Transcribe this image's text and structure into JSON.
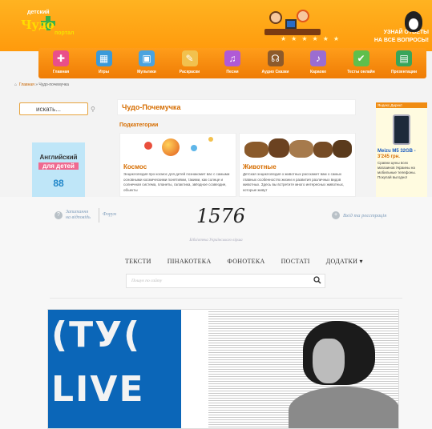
{
  "top_site": {
    "logo": {
      "prefix": "детский",
      "name_a": "Чудо",
      "name_b": "Чудо",
      "suffix": "портал"
    },
    "slogan_line1": "УЗНАЙ ОТВЕТЫ",
    "slogan_line2": "НА ВСЕ ВОПРОСЫ!",
    "nav": [
      {
        "label": "Главная",
        "icon": "puzzle-icon",
        "color": "#e94f8a",
        "glyph": "✚"
      },
      {
        "label": "Игры",
        "icon": "blocks-icon",
        "color": "#3b9ad9",
        "glyph": "▦"
      },
      {
        "label": "Мультики",
        "icon": "tv-icon",
        "color": "#4aa3df",
        "glyph": "▣"
      },
      {
        "label": "Раскраски",
        "icon": "palette-icon",
        "color": "#f2c14e",
        "glyph": "✎"
      },
      {
        "label": "Песни",
        "icon": "music-icon",
        "color": "#b05ad6",
        "glyph": "♫"
      },
      {
        "label": "Аудио Сказки",
        "icon": "audio-tales-icon",
        "color": "#8d5a2b",
        "glyph": "☊"
      },
      {
        "label": "Караоке",
        "icon": "karaoke-icon",
        "color": "#9b6dd1",
        "glyph": "♪"
      },
      {
        "label": "Тесты онлайн",
        "icon": "tests-icon",
        "color": "#5fbf4c",
        "glyph": "✔"
      },
      {
        "label": "Презентации",
        "icon": "presentation-icon",
        "color": "#38a55a",
        "glyph": "▤"
      }
    ],
    "breadcrumb": {
      "home": "Главная",
      "sep": "»",
      "current": "Чудо-почемучка"
    },
    "search_placeholder": "искать...",
    "page_title": "Чудо-Почемучка",
    "subcategories_title": "Подкатегории",
    "cards": [
      {
        "title": "Космос",
        "text": "Энциклопедия про космос для детей познакомит вас с самыми основными космическими понятиями, такими, как солнце и солнечная система, планеты, галактика, звёздное созвездие, объекты"
      },
      {
        "title": "Животные",
        "text": "Детская энциклопедия о животных расскажет вам о самых главных особенностях жизни и развития различных видов животных. Здесь вы встретите много интересных животных, которые живут"
      }
    ],
    "ad": {
      "line1": "Английский",
      "line2": "для детей",
      "line3": "88"
    },
    "market": {
      "tag": "Яндекс.Директ",
      "product": "Meizu M5 32GB -",
      "price": "3'245 грн.",
      "text": "Сравни цены всех магазинов Украины на мобильные телефоны. Покупай выгодно!"
    }
  },
  "bottom_site": {
    "remember_line1": "Запитання",
    "remember_line2": "на відповідь",
    "forum": "Форум",
    "logo": "1576",
    "login": "Вхід та реєстрація",
    "tagline": "Бібліотека Українського вірша",
    "menu": [
      "ТЕКСТИ",
      "ПІНАКОТЕКА",
      "ФОНОТЕКА",
      "ПОСТАТІ",
      "ДОДАТКИ ▾"
    ],
    "search_placeholder": "Пошук по сайту",
    "poster_line1": "(ТУ(",
    "poster_line2": "LIVE"
  }
}
